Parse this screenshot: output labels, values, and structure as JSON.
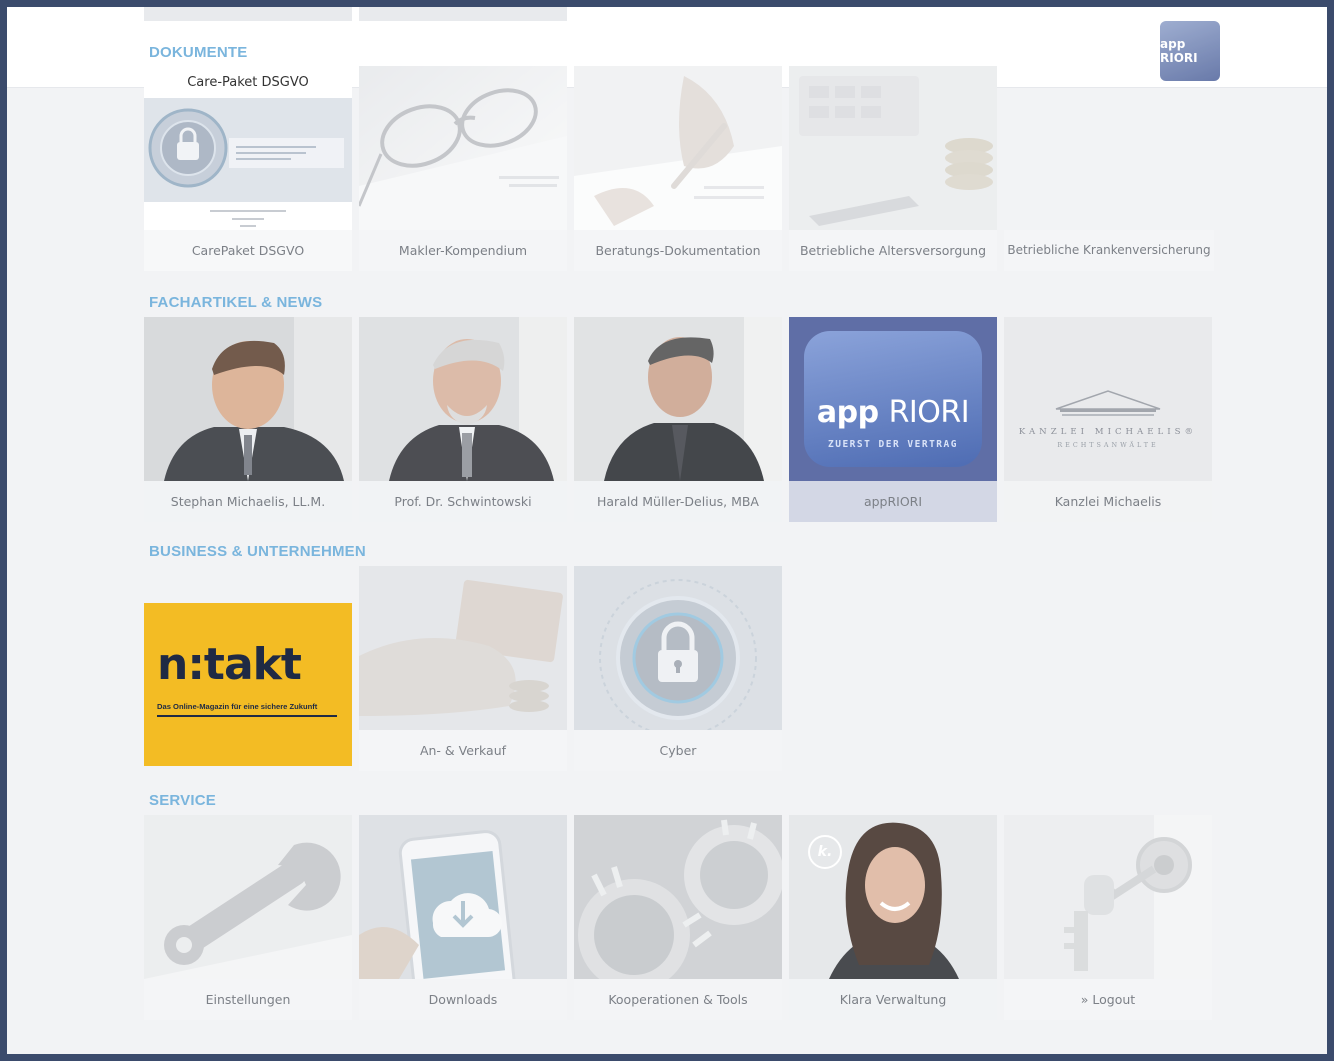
{
  "header": {
    "logo_alt": "appRIORI",
    "logo_text": "app RIORI"
  },
  "sections": {
    "dokumente": {
      "title": "DOKUMENTE",
      "tiles": [
        {
          "label": "CarePaket DSGVO",
          "image_title": "Care-Paket DSGVO"
        },
        {
          "label": "Makler-Kompendium"
        },
        {
          "label": "Beratungs-Dokumentation"
        },
        {
          "label": "Betriebliche Altersversorgung"
        },
        {
          "label": "Betriebliche Krankenversicherung"
        }
      ]
    },
    "fachartikel": {
      "title": "FACHARTIKEL & NEWS",
      "tiles": [
        {
          "label": "Stephan Michaelis, LL.M."
        },
        {
          "label": "Prof. Dr. Schwintowski"
        },
        {
          "label": "Harald Müller-Delius, MBA"
        },
        {
          "label": "appRIORI",
          "logo_word_bold": "app",
          "logo_word_thin": "RIORI",
          "logo_tagline": "ZUERST DER VERTRAG"
        },
        {
          "label": "Kanzlei Michaelis",
          "logo_name": "KANZLEI MICHAELIS®",
          "logo_sub": "RECHTSANWÄLTE"
        }
      ]
    },
    "business": {
      "title": "BUSINESS & UNTERNEHMEN",
      "tiles": [
        {
          "label": "",
          "logo": "n:takt",
          "tagline": "Das Online-Magazin für eine sichere Zukunft"
        },
        {
          "label": "An- & Verkauf"
        },
        {
          "label": "Cyber"
        }
      ]
    },
    "service": {
      "title": "SERVICE",
      "tiles": [
        {
          "label": "Einstellungen"
        },
        {
          "label": "Downloads"
        },
        {
          "label": "Kooperationen & Tools"
        },
        {
          "label": "Klara Verwaltung",
          "badge": "k."
        },
        {
          "label": "» Logout"
        }
      ]
    }
  },
  "colors": {
    "section_title": "#7ab5dd",
    "ntakt_yellow": "#f3bc24",
    "ntakt_navy": "#1f2a44",
    "approri_blue": "#4e6cb3",
    "frame": "#3b4b6c"
  }
}
